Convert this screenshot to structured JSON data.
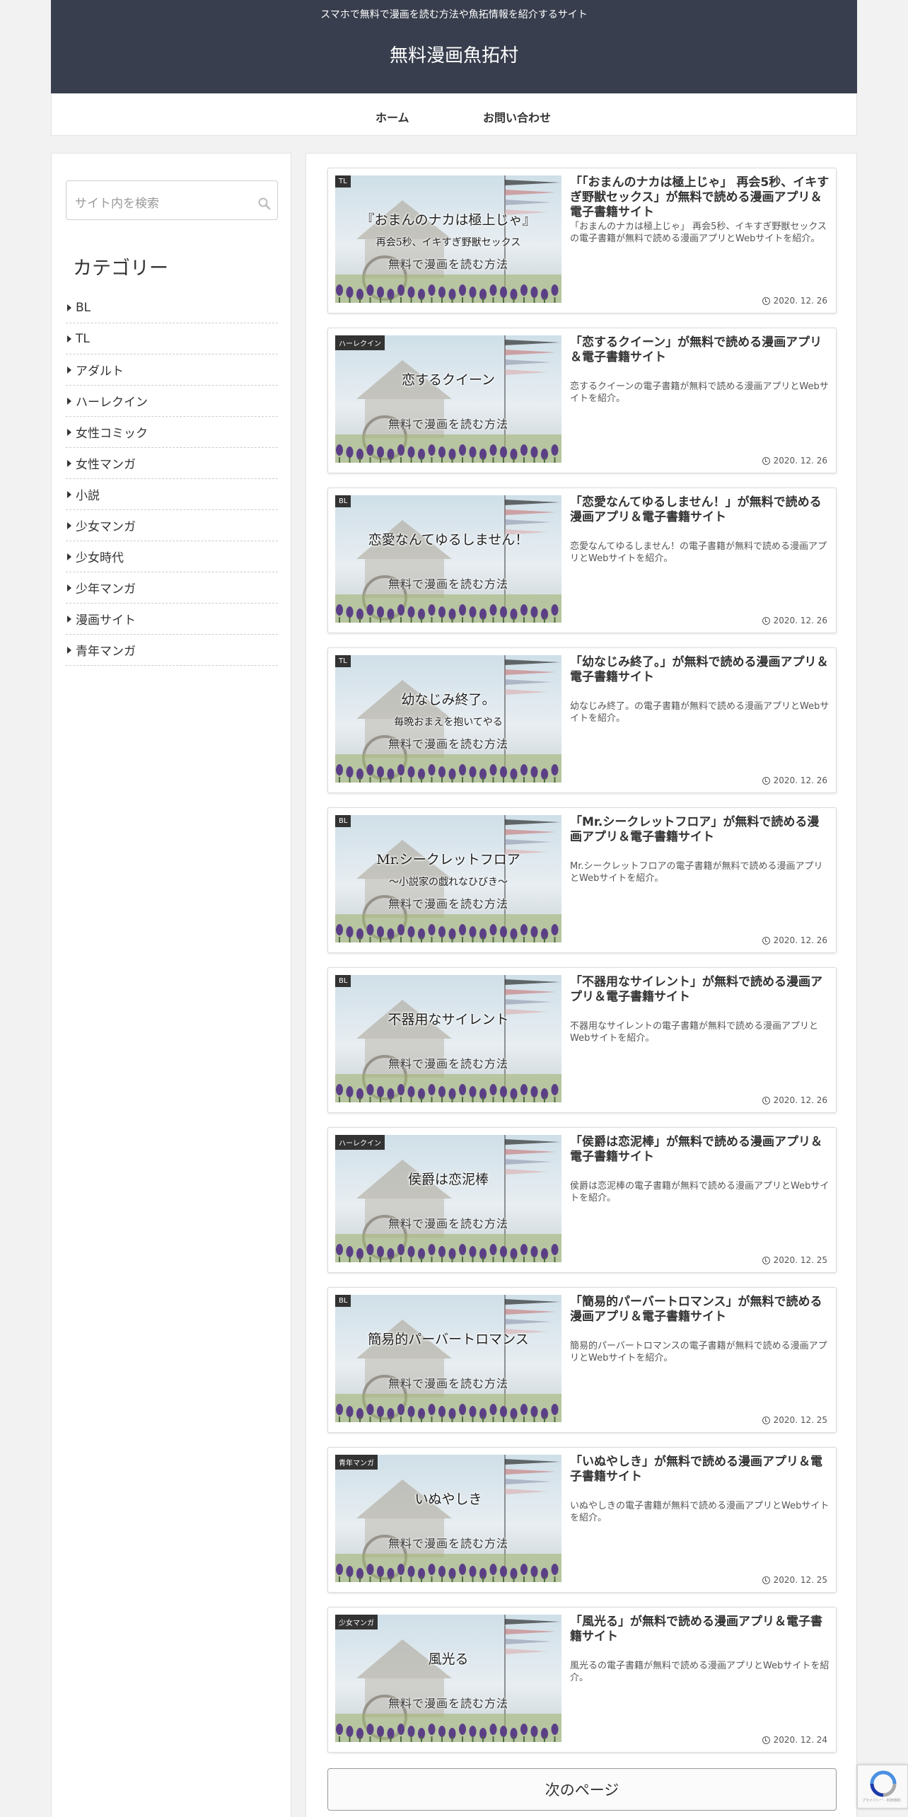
{
  "header": {
    "tagline": "スマホで無料で漫画を読む方法や魚拓情報を紹介するサイト",
    "site_title": "無料漫画魚拓村"
  },
  "nav": {
    "home": "ホーム",
    "contact": "お問い合わせ"
  },
  "sidebar": {
    "search_placeholder": "サイト内を検索",
    "category_heading": "カテゴリー",
    "categories": [
      "BL",
      "TL",
      "アダルト",
      "ハーレクイン",
      "女性コミック",
      "女性マンガ",
      "小説",
      "少女マンガ",
      "少女時代",
      "少年マンガ",
      "漫画サイト",
      "青年マンガ"
    ]
  },
  "posts": [
    {
      "badge": "TL",
      "thumb_title": "『おまんのナカは極上じゃ』",
      "thumb_sub": "再会5秒、イキすぎ野獣セックス",
      "thumb_tag": "無料で漫画を読む方法",
      "title": "「「おまんのナカは極上じゃ」 再会5秒、イキすぎ野獣セックス」が無料で読める漫画アプリ＆電子書籍サイト",
      "snippet": "「おまんのナカは極上じゃ」 再会5秒、イキすぎ野獣セックスの電子書籍が無料で読める漫画アプリとWebサイトを紹介。",
      "date": "2020. 12. 26"
    },
    {
      "badge": "ハーレクイン",
      "thumb_title": "恋するクイーン",
      "thumb_sub": "",
      "thumb_tag": "無料で漫画を読む方法",
      "title": "「恋するクイーン」が無料で読める漫画アプリ＆電子書籍サイト",
      "snippet": "恋するクイーンの電子書籍が無料で読める漫画アプリとWebサイトを紹介。",
      "date": "2020. 12. 26"
    },
    {
      "badge": "BL",
      "thumb_title": "恋愛なんてゆるしません！",
      "thumb_sub": "",
      "thumb_tag": "無料で漫画を読む方法",
      "title": "「恋愛なんてゆるしません！」が無料で読める漫画アプリ＆電子書籍サイト",
      "snippet": "恋愛なんてゆるしません！の電子書籍が無料で読める漫画アプリとWebサイトを紹介。",
      "date": "2020. 12. 26"
    },
    {
      "badge": "TL",
      "thumb_title": "幼なじみ終了。",
      "thumb_sub": "毎晩おまえを抱いてやる",
      "thumb_tag": "無料で漫画を読む方法",
      "title": "「幼なじみ終了。」が無料で読める漫画アプリ＆電子書籍サイト",
      "snippet": "幼なじみ終了。の電子書籍が無料で読める漫画アプリとWebサイトを紹介。",
      "date": "2020. 12. 26"
    },
    {
      "badge": "BL",
      "thumb_title": "Mr.シークレットフロア",
      "thumb_sub": "～小説家の戯れなひびき～",
      "thumb_tag": "無料で漫画を読む方法",
      "title": "「Mr.シークレットフロア」が無料で読める漫画アプリ＆電子書籍サイト",
      "snippet": "Mr.シークレットフロアの電子書籍が無料で読める漫画アプリとWebサイトを紹介。",
      "date": "2020. 12. 26"
    },
    {
      "badge": "BL",
      "thumb_title": "不器用なサイレント",
      "thumb_sub": "",
      "thumb_tag": "無料で漫画を読む方法",
      "title": "「不器用なサイレント」が無料で読める漫画アプリ＆電子書籍サイト",
      "snippet": "不器用なサイレントの電子書籍が無料で読める漫画アプリとWebサイトを紹介。",
      "date": "2020. 12. 26"
    },
    {
      "badge": "ハーレクイン",
      "thumb_title": "侯爵は恋泥棒",
      "thumb_sub": "",
      "thumb_tag": "無料で漫画を読む方法",
      "title": "「侯爵は恋泥棒」が無料で読める漫画アプリ＆電子書籍サイト",
      "snippet": "侯爵は恋泥棒の電子書籍が無料で読める漫画アプリとWebサイトを紹介。",
      "date": "2020. 12. 25"
    },
    {
      "badge": "BL",
      "thumb_title": "簡易的パーバートロマンス",
      "thumb_sub": "",
      "thumb_tag": "無料で漫画を読む方法",
      "title": "「簡易的パーバートロマンス」が無料で読める漫画アプリ＆電子書籍サイト",
      "snippet": "簡易的パーバートロマンスの電子書籍が無料で読める漫画アプリとWebサイトを紹介。",
      "date": "2020. 12. 25"
    },
    {
      "badge": "青年マンガ",
      "thumb_title": "いぬやしき",
      "thumb_sub": "",
      "thumb_tag": "無料で漫画を読む方法",
      "title": "「いぬやしき」が無料で読める漫画アプリ＆電子書籍サイト",
      "snippet": "いぬやしきの電子書籍が無料で読める漫画アプリとWebサイトを紹介。",
      "date": "2020. 12. 25"
    },
    {
      "badge": "少女マンガ",
      "thumb_title": "風光る",
      "thumb_sub": "",
      "thumb_tag": "無料で漫画を読む方法",
      "title": "「風光る」が無料で読める漫画アプリ＆電子書籍サイト",
      "snippet": "風光るの電子書籍が無料で読める漫画アプリとWebサイトを紹介。",
      "date": "2020. 12. 24"
    }
  ],
  "pagination": {
    "next_label": "次のページ"
  },
  "recaptcha": {
    "footer_text": "プライバシー - 利用規約"
  }
}
